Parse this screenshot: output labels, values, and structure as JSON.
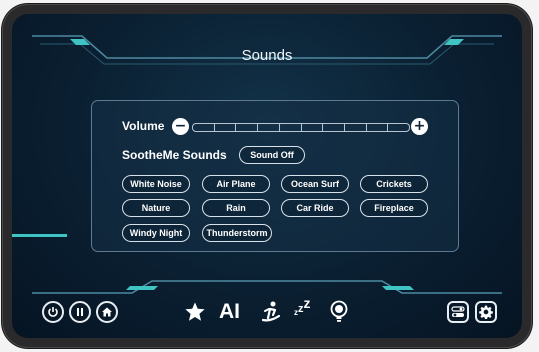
{
  "screen": {
    "title": "Sounds"
  },
  "volume": {
    "label": "Volume",
    "segments": 10,
    "level": 0
  },
  "soothe": {
    "label": "SootheMe Sounds",
    "sound_off": "Sound Off"
  },
  "sounds": [
    "White Noise",
    "Air Plane",
    "Ocean Surf",
    "Crickets",
    "Nature",
    "Rain",
    "Car Ride",
    "Fireplace",
    "Windy Night",
    "Thunderstorm"
  ],
  "bottom": {
    "ai_label": "AI",
    "zzz": "zᶻz"
  },
  "colors": {
    "accent": "#3fc3c3",
    "screen_bg": "#0a1f31",
    "text": "#ffffff"
  },
  "icons": [
    "power-icon",
    "pause-icon",
    "home-icon",
    "star-icon",
    "massage-icon",
    "sleep-icon",
    "bulb-icon",
    "toggle-icon",
    "gear-icon"
  ]
}
